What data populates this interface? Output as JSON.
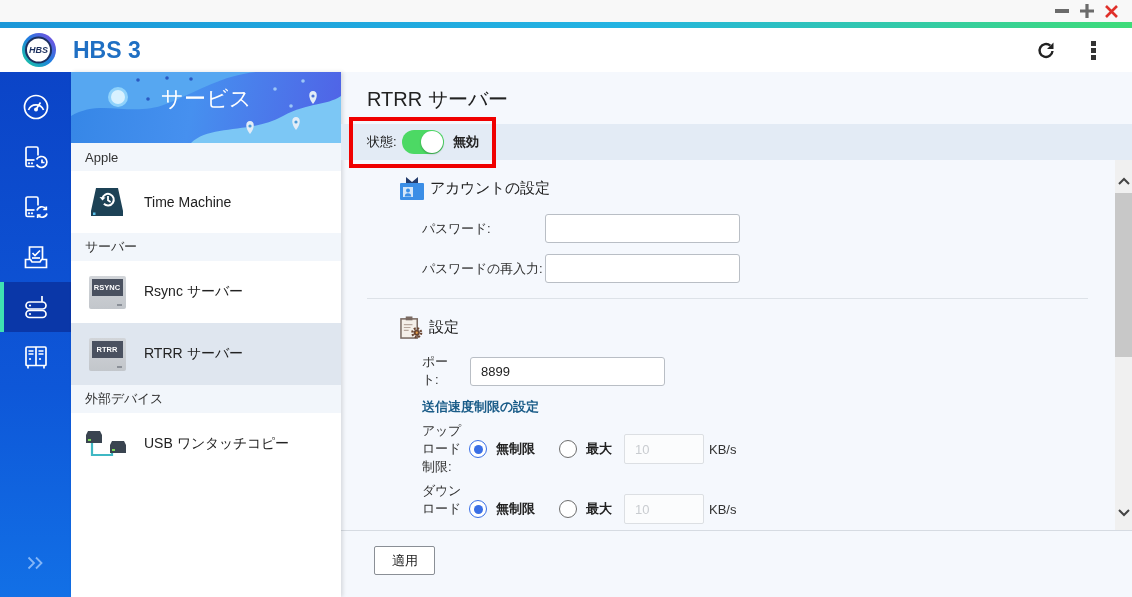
{
  "app": {
    "logo_text": "HBS",
    "name": "HBS 3"
  },
  "nav": {
    "items": [
      {
        "kind": "gauge",
        "selected": false
      },
      {
        "kind": "backup",
        "selected": false
      },
      {
        "kind": "sync",
        "selected": false
      },
      {
        "kind": "jobs",
        "selected": false
      },
      {
        "kind": "services",
        "selected": true
      },
      {
        "kind": "storage",
        "selected": false
      }
    ]
  },
  "services_panel": {
    "banner_title": "サービス",
    "groups": [
      {
        "title": "Apple",
        "items": [
          {
            "kind": "time-machine",
            "label": "Time Machine",
            "selected": false
          }
        ]
      },
      {
        "title": "サーバー",
        "items": [
          {
            "kind": "server",
            "badge": "RSYNC",
            "label": "Rsync サーバー",
            "selected": false
          },
          {
            "kind": "server",
            "badge": "RTRR",
            "label": "RTRR サーバー",
            "selected": true
          }
        ]
      },
      {
        "title": "外部デバイス",
        "items": [
          {
            "kind": "usb-copy",
            "label": "USB ワンタッチコピー",
            "selected": false
          }
        ]
      }
    ]
  },
  "main": {
    "title": "RTRR サーバー",
    "status": {
      "label": "状態:",
      "on": true,
      "text": "無効",
      "highlighted": true
    },
    "sections": [
      {
        "kind": "account",
        "title": "アカウントの設定",
        "fields": [
          {
            "kind": "password",
            "label": "パスワード:"
          },
          {
            "kind": "password",
            "label": "パスワードの再入力:"
          }
        ]
      },
      {
        "kind": "settings",
        "title": "設定",
        "fields": [
          {
            "kind": "text",
            "label": "ポート:",
            "value": "8899"
          }
        ],
        "subheading": "送信速度制限の設定",
        "limits": [
          {
            "label": "アップロード制限:",
            "options": [
              {
                "label": "無制限",
                "selected": true
              },
              {
                "label": "最大",
                "selected": false
              }
            ],
            "max_value": "10",
            "max_disabled": true,
            "unit": "KB/s"
          },
          {
            "label": "ダウンロード",
            "options": [
              {
                "label": "無制限",
                "selected": true
              },
              {
                "label": "最大",
                "selected": false
              }
            ],
            "max_value": "10",
            "max_disabled": true,
            "unit": "KB/s"
          }
        ]
      }
    ],
    "footer": {
      "apply_button": "適用"
    }
  }
}
